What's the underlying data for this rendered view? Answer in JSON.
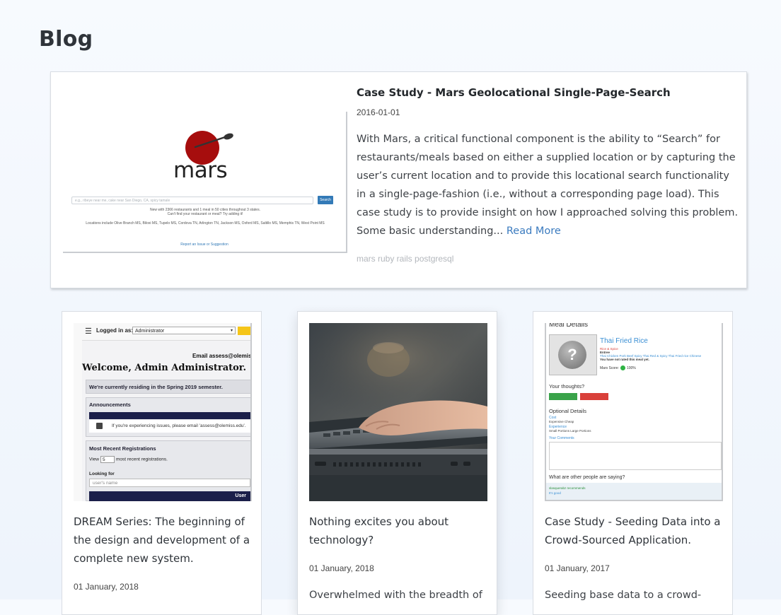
{
  "page": {
    "title": "Blog"
  },
  "featured": {
    "title": "Case Study - Mars Geolocational Single-Page-Search",
    "date": "2016-01-01",
    "excerpt": "With Mars, a critical functional component is the ability to “Search” for restaurants/meals based on either a supplied location or by capturing the user’s current location and to provide this locational search functionality in a single-page-fashion (i.e., without a corresponding page load). This case study is to provide insight on how I approached solving this problem. Some basic understanding...",
    "read_more": "Read More",
    "tags": "mars ruby rails postgresql",
    "image": {
      "logo_text": "mars",
      "search_placeholder": "e.g., ribeye near me, cake near San Diego, CA, spicy tamale",
      "search_button": "Search",
      "stats_line1": "New with 2366 restaurants and 1 meal in 50 cities throughout 3 states.",
      "stats_line2": "Can't find your restaurant or meal? Try adding it!",
      "locations": "Locations include Olive Branch MS, Biloxi MS, Tupelo MS, Cordova TN, Arlington TN, Jackson MS, Oxford MS, Saltillo MS, Memphis TN, West Point MS",
      "report_link": "Report an Issue or Suggestion"
    }
  },
  "cards": [
    {
      "title": "DREAM Series: The beginning of the design and development of a complete new system.",
      "date": "01 January, 2018",
      "excerpt": "",
      "image": {
        "logged_in_label": "Logged in as:",
        "role_value": "Administrator",
        "email": "Email assess@olemiss.ed",
        "welcome": "Welcome, Admin Administrator.",
        "semester": "We're currently residing in the Spring 2019 semester.",
        "announcements": "Announcements",
        "announcement_text": "If you're experiencing issues, please email 'assess@olemiss.edu'.",
        "recent_title": "Most Recent Registrations",
        "view_prefix": "View",
        "view_value": "5",
        "view_suffix": "most recent registrations.",
        "looking_for": "Looking for",
        "name_placeholder": "user's name",
        "user_header": "User"
      }
    },
    {
      "title": "Nothing excites you about technology?",
      "date": "01 January, 2018",
      "excerpt": "Overwhelmed with the breadth of"
    },
    {
      "title": "Case Study - Seeding Data into a Crowd-Sourced Application.",
      "date": "01 January, 2017",
      "excerpt": "Seeding base data to a crowd-",
      "image": {
        "heading": "Meal Details",
        "dish": "Thai Fried Rice",
        "tag1": "Rice & Spice",
        "tag2": "Entree",
        "tag3": "Thai Chicken Pork Beef Spicy Thai Red & Spicy Thai Fried rice Chinese",
        "note": "You have not rated this meal yet.",
        "score": "Mars Score:",
        "score_value": "100%",
        "thoughts": "Your thoughts?",
        "optional": "Optional Details",
        "cost": "Cost",
        "cost_opts": "Expensive   Cheap",
        "experience": "Experience",
        "exp_opts": "Small Portions   Large Portions",
        "comments": "Your Comments",
        "others": "What are other people are saying?",
        "other_user": "slasquerabz recommends",
        "other_text": "It's good"
      }
    }
  ],
  "colors": {
    "link": "#3b7bbf",
    "tags": "#b3b7bc",
    "mars_red": "#a60d0d"
  }
}
